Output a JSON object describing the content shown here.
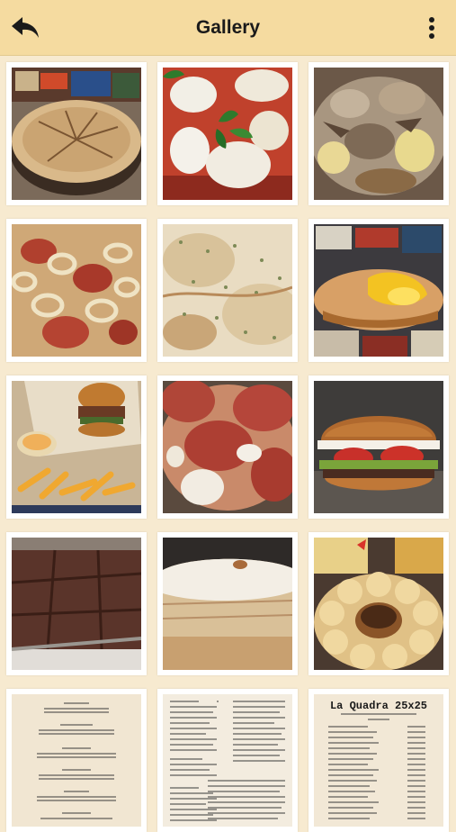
{
  "header": {
    "title": "Gallery",
    "back_icon": "back-arrow-icon",
    "menu_icon": "more-vertical-icon"
  },
  "gallery": {
    "items": [
      {
        "subject": "pizza-pie"
      },
      {
        "subject": "caprese-pizza"
      },
      {
        "subject": "mushroom-pizza"
      },
      {
        "subject": "onion-bacon-pizza"
      },
      {
        "subject": "herb-pizza"
      },
      {
        "subject": "egg-pizza"
      },
      {
        "subject": "burger-fries"
      },
      {
        "subject": "salami-pizza"
      },
      {
        "subject": "burger"
      },
      {
        "subject": "brownies"
      },
      {
        "subject": "cheese-lasagna"
      },
      {
        "subject": "bread-ring"
      },
      {
        "subject": "menu-page-1"
      },
      {
        "subject": "menu-page-2"
      },
      {
        "subject": "menu-page-3",
        "caption": "La Quadra 25x25"
      }
    ]
  }
}
